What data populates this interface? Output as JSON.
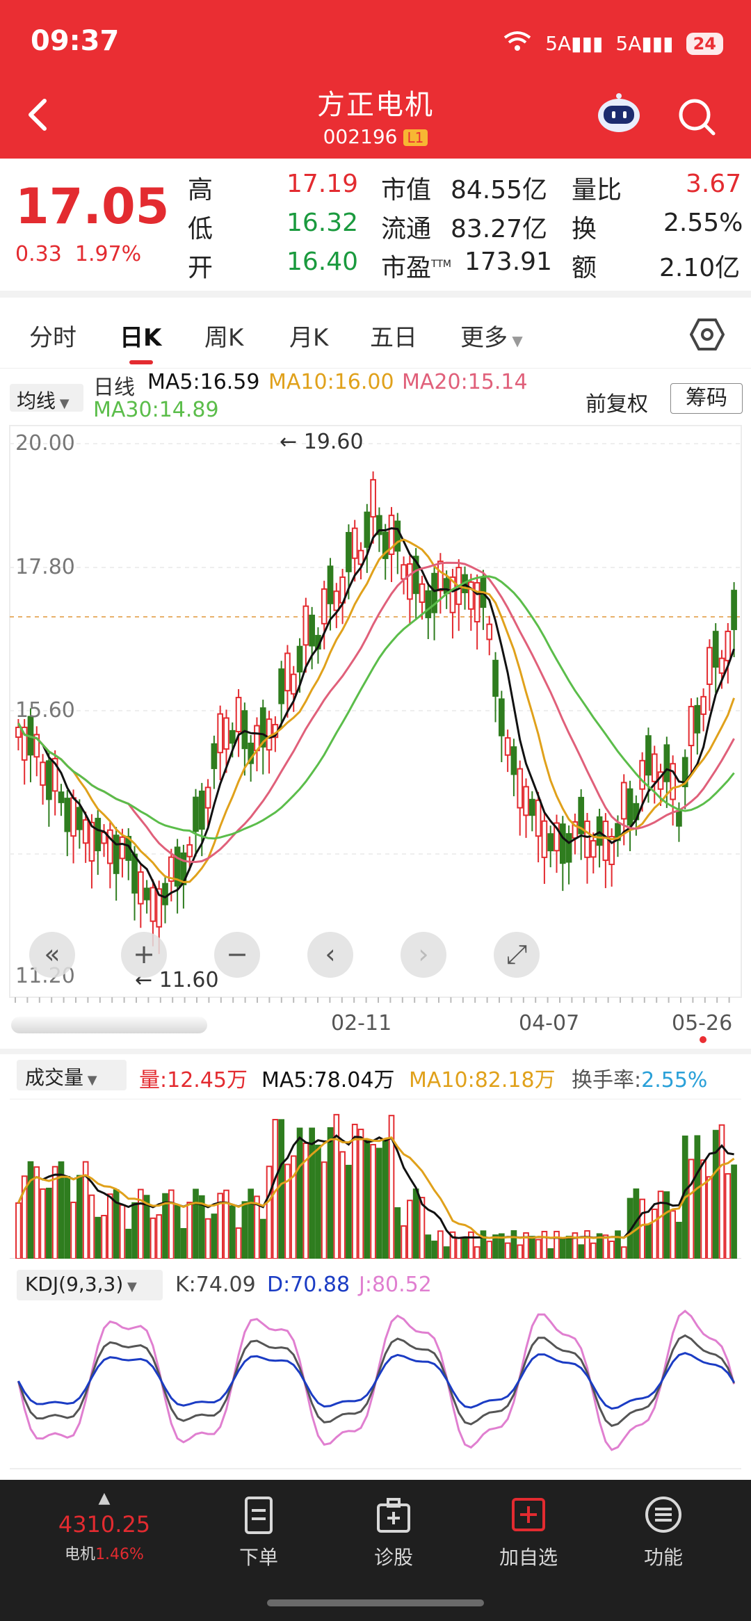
{
  "status": {
    "time": "09:37",
    "signal": "5A",
    "battery": "24"
  },
  "header": {
    "name": "方正电机",
    "code": "002196",
    "badge": "L1"
  },
  "quote": {
    "price": "17.05",
    "change": "0.33",
    "change_pct": "1.97%",
    "high_label": "高",
    "high": "17.19",
    "low_label": "低",
    "low": "16.32",
    "open_label": "开",
    "open": "16.40",
    "mktcap_label": "市值",
    "mktcap": "84.55亿",
    "float_label": "流通",
    "float": "83.27亿",
    "pe_label": "市盈",
    "pe_sup": "TTM",
    "pe": "173.91",
    "vr_label": "量比",
    "vr": "3.67",
    "turnover_label": "换",
    "turnover": "2.55%",
    "amount_label": "额",
    "amount": "2.10亿"
  },
  "tabs": [
    "分时",
    "日K",
    "周K",
    "月K",
    "五日",
    "更多"
  ],
  "active_tab": "日K",
  "kline": {
    "ma_selector": "均线",
    "line_type": "日线",
    "ma5": "MA5:16.59",
    "ma10": "MA10:16.00",
    "ma20": "MA20:15.14",
    "ma30": "MA30:14.89",
    "fuquan": "前复权",
    "chouma": "筹码",
    "y_labels": [
      "20.00",
      "17.80",
      "15.60",
      "11.20"
    ],
    "high_marker": "19.60",
    "low_marker": "11.60",
    "x_labels": [
      "02-11",
      "04-07",
      "05-26"
    ]
  },
  "colors": {
    "up": "#e32b30",
    "down": "#2f7d1f",
    "ma5": "#111111",
    "ma10": "#e0a11b",
    "ma20": "#e0607a",
    "ma30": "#5bbd4a"
  },
  "volume": {
    "selector": "成交量",
    "vol": "量:12.45万",
    "ma5": "MA5:78.04万",
    "ma10": "MA10:82.18万",
    "turnover_label": "换手率:",
    "turnover": "2.55%"
  },
  "kdj": {
    "selector": "KDJ(9,3,3)",
    "k": "K:74.09",
    "d": "D:70.88",
    "j": "J:80.52"
  },
  "bottom": {
    "index_value": "4310.25",
    "index_name": "电机",
    "index_pct": "1.46%",
    "items": [
      "下单",
      "诊股",
      "加自选",
      "功能"
    ]
  }
}
